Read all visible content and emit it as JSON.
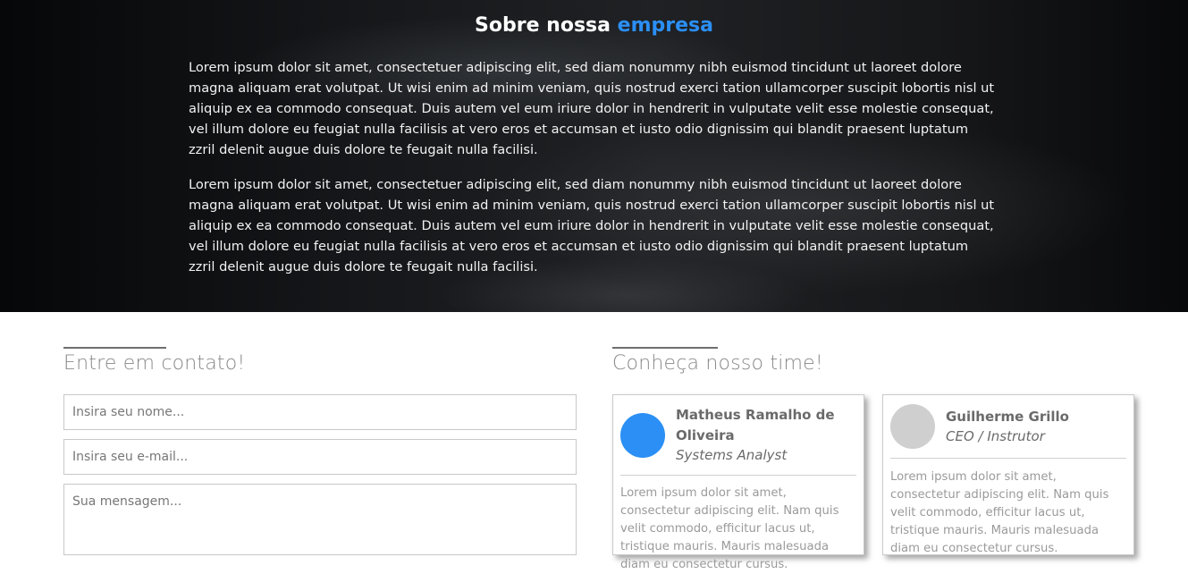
{
  "about": {
    "title_prefix": "Sobre nossa",
    "title_accent": "empresa",
    "paragraphs": [
      "Lorem ipsum dolor sit amet, consectetuer adipiscing elit, sed diam nonummy nibh euismod tincidunt ut laoreet dolore magna aliquam erat volutpat. Ut wisi enim ad minim veniam, quis nostrud exerci tation ullamcorper suscipit lobortis nisl ut aliquip ex ea commodo consequat. Duis autem vel eum iriure dolor in hendrerit in vulputate velit esse molestie consequat, vel illum dolore eu feugiat nulla facilisis at vero eros et accumsan et iusto odio dignissim qui blandit praesent luptatum zzril delenit augue duis dolore te feugait nulla facilisi.",
      "Lorem ipsum dolor sit amet, consectetuer adipiscing elit, sed diam nonummy nibh euismod tincidunt ut laoreet dolore magna aliquam erat volutpat. Ut wisi enim ad minim veniam, quis nostrud exerci tation ullamcorper suscipit lobortis nisl ut aliquip ex ea commodo consequat. Duis autem vel eum iriure dolor in hendrerit in vulputate velit esse molestie consequat, vel illum dolore eu feugiat nulla facilisis at vero eros et accumsan et iusto odio dignissim qui blandit praesent luptatum zzril delenit augue duis dolore te feugait nulla facilisi."
    ]
  },
  "contact": {
    "title": "Entre em contato!",
    "name_placeholder": "Insira seu nome...",
    "email_placeholder": "Insira seu e-mail...",
    "message_placeholder": "Sua mensagem..."
  },
  "team": {
    "title": "Conheça nosso time!",
    "members": [
      {
        "name": "Matheus Ramalho de Oliveira",
        "role": "Systems Analyst",
        "bio": "Lorem ipsum dolor sit amet, consectetur adipiscing elit. Nam quis velit commodo, efficitur lacus ut, tristique mauris. Mauris malesuada diam eu consectetur cursus.",
        "avatar_color": "#2b8ff5"
      },
      {
        "name": "Guilherme Grillo",
        "role": "CEO / Instrutor",
        "bio": "Lorem ipsum dolor sit amet, consectetur adipiscing elit. Nam quis velit commodo, efficitur lacus ut, tristique mauris. Mauris malesuada diam eu consectetur cursus.",
        "avatar_color": "#cfcfcf"
      }
    ]
  },
  "colors": {
    "accent": "#2b8ff5"
  }
}
